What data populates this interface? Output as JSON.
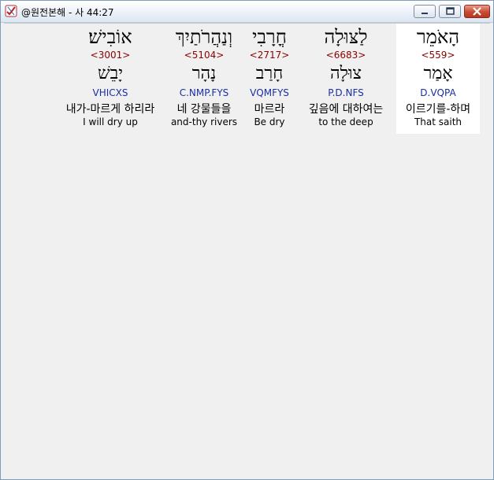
{
  "window": {
    "title": "@원전본해 - 사 44:27",
    "icon": "checkmark-app-icon"
  },
  "words": [
    {
      "hebrew": "הָאֹמֵר",
      "strong": "<559>",
      "lemma": "אָמַר",
      "morph": "D.VQPA",
      "korean": "이르기를-하며",
      "english": "That saith",
      "selected": true
    },
    {
      "hebrew": "לַצּוּלָה",
      "strong": "<6683>",
      "lemma": "צוּלָה",
      "morph": "P.D.NFS",
      "korean": "깊음에 대하여는",
      "english": "to the deep",
      "selected": false
    },
    {
      "hebrew": "חֳרָבִי",
      "strong": "<2717>",
      "lemma": "חָרַב",
      "morph": "VQMFYS",
      "korean": "마르라",
      "english": "Be dry",
      "selected": false
    },
    {
      "hebrew": "וְנַהֲרֹתַיִךְ",
      "strong": "<5104>",
      "lemma": "נָהָר",
      "morph": "C.NMP.FYS",
      "korean": "네 강물들을",
      "english": "and-thy rivers",
      "selected": false
    },
    {
      "hebrew": "אוֹבִישׁ׃",
      "strong": "<3001>",
      "lemma": "יָבֵשׁ",
      "morph": "VHICXS",
      "korean": "내가-마르게 하리라",
      "english": "I will dry up",
      "selected": false
    }
  ]
}
